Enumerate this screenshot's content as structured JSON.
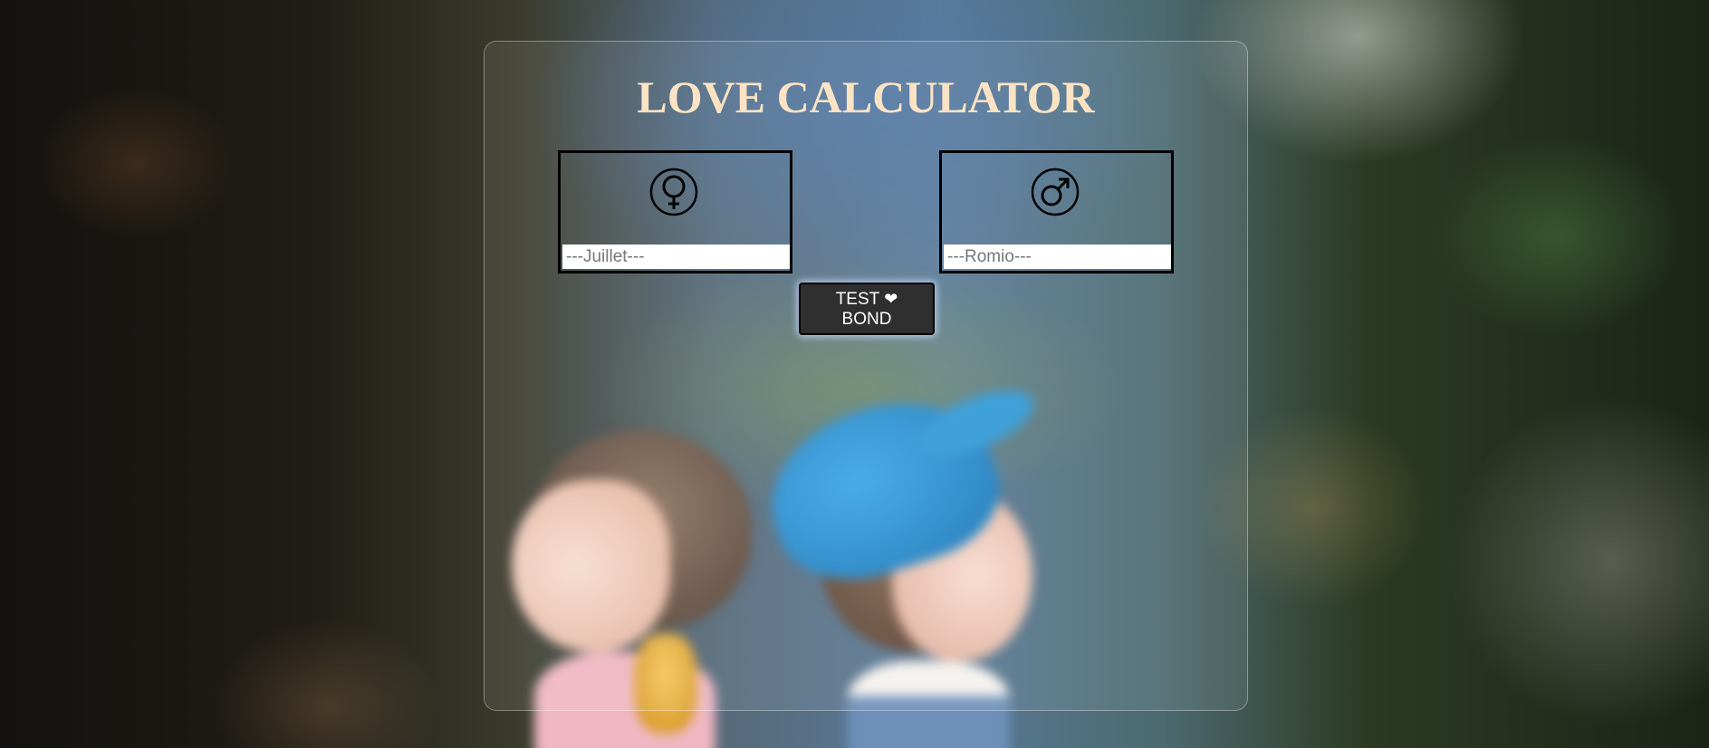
{
  "app": {
    "title": "LOVE CALCULATOR"
  },
  "female": {
    "icon": "female-symbol-icon",
    "placeholder": "---Juillet---",
    "value": ""
  },
  "male": {
    "icon": "male-symbol-icon",
    "placeholder": "---Romio---",
    "value": ""
  },
  "test_button": {
    "line1": "TEST",
    "heart": "❤",
    "line2": "BOND"
  },
  "colors": {
    "title": "#fbe3c3",
    "button_bg": "#2f2f2f",
    "button_glow": "#c8d7ff",
    "box_border": "#000000"
  }
}
